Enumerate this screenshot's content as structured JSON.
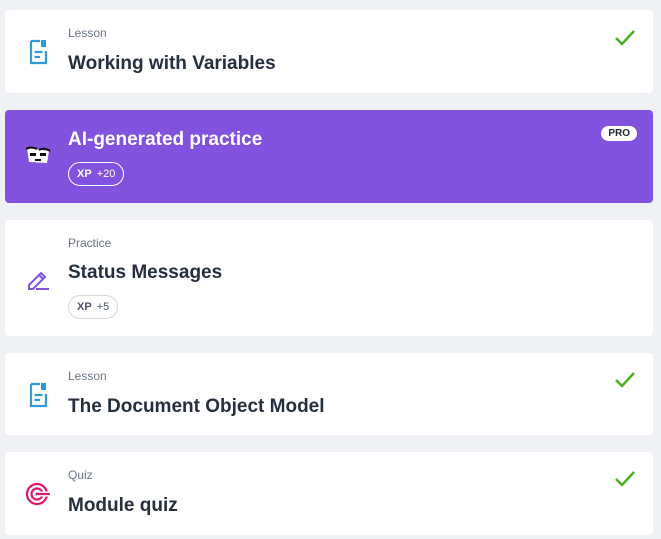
{
  "items": [
    {
      "type_label": "Lesson",
      "title": "Working with Variables",
      "completed": true,
      "icon": "lesson-document-icon"
    },
    {
      "title": "AI-generated practice",
      "badge": "PRO",
      "xp": {
        "key": "XP",
        "value": "+20"
      },
      "icon": "ai-mascot-icon"
    },
    {
      "type_label": "Practice",
      "title": "Status Messages",
      "xp": {
        "key": "XP",
        "value": "+5"
      },
      "icon": "pencil-icon"
    },
    {
      "type_label": "Lesson",
      "title": "The Document Object Model",
      "completed": true,
      "icon": "lesson-document-icon"
    },
    {
      "type_label": "Quiz",
      "title": "Module quiz",
      "completed": true,
      "icon": "target-icon"
    }
  ],
  "colors": {
    "pro_background": "#8152dd",
    "check": "#4caf22",
    "lesson_icon": "#2f9bd8",
    "practice_icon": "#8152dd",
    "quiz_icon": "#e0196b"
  }
}
